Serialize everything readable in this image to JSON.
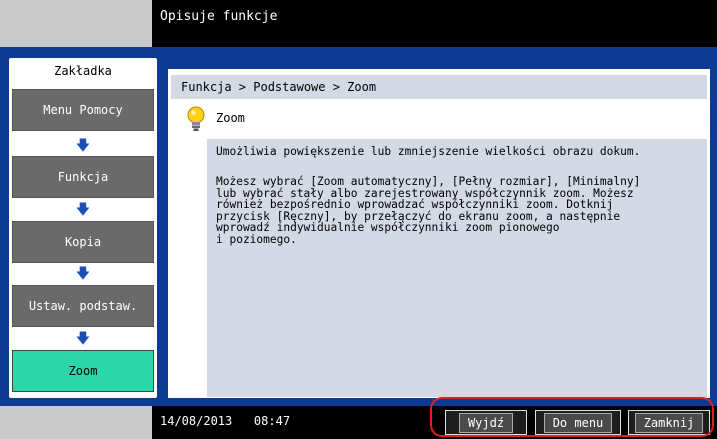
{
  "header": {
    "title": "Opisuje funkcje"
  },
  "sidebar": {
    "title": "Zakładka",
    "items": [
      {
        "label": "Menu Pomocy"
      },
      {
        "label": "Funkcja"
      },
      {
        "label": "Kopia"
      },
      {
        "label": "Ustaw. podstaw."
      },
      {
        "label": "Zoom"
      }
    ],
    "arrow": "🡇"
  },
  "main": {
    "breadcrumb": "Funkcja > Podstawowe > Zoom",
    "heading": "Zoom",
    "description_p1": "Umożliwia powiększenie lub zmniejszenie wielkości obrazu dokum.",
    "description_p2": "Możesz wybrać [Zoom automatyczny], [Pełny rozmiar], [Minimalny]\nlub wybrać stały albo zarejestrowany współczynnik zoom. Możesz\nrównież bezpośrednio wprowadzać współczynniki zoom. Dotknij\nprzycisk [Ręczny], by przełączyć do ekranu zoom, a następnie\nwprowadź indywidualnie współczynniki zoom pionowego\ni poziomego."
  },
  "footer": {
    "datetime": "14/08/2013   08:47",
    "buttons": {
      "exit": "Wyjdź",
      "menu": "Do menu",
      "close": "Zamknij"
    }
  },
  "colors": {
    "frame": "#0d3a93",
    "active_tab": "#2bd6a8",
    "panel": "#d4d9e6",
    "highlight": "#e02020"
  },
  "icons": {
    "heading": "lightbulb-icon",
    "step_arrow": "arrow-down-icon"
  }
}
